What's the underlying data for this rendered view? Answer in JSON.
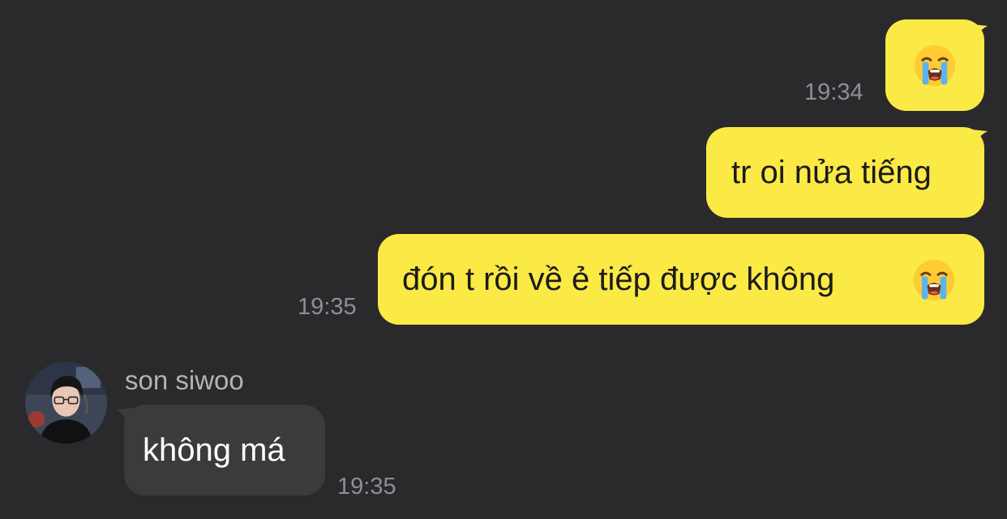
{
  "theme": {
    "background": "#2a2a2d",
    "outgoing_bubble": "#fbea45",
    "incoming_bubble": "#3b3b3e",
    "timestamp_color": "#8e8e93"
  },
  "messages": [
    {
      "direction": "outgoing",
      "content": "loudly-crying-face-emoji",
      "time": "19:34"
    },
    {
      "direction": "outgoing",
      "text": "tr oi nửa tiếng"
    },
    {
      "direction": "outgoing",
      "text": "đón t rồi về ẻ tiếp được không",
      "trailing_emoji": "loudly-crying-face-emoji",
      "time": "19:35"
    },
    {
      "direction": "incoming",
      "sender": "son siwoo",
      "text": "không má",
      "time": "19:35"
    }
  ]
}
